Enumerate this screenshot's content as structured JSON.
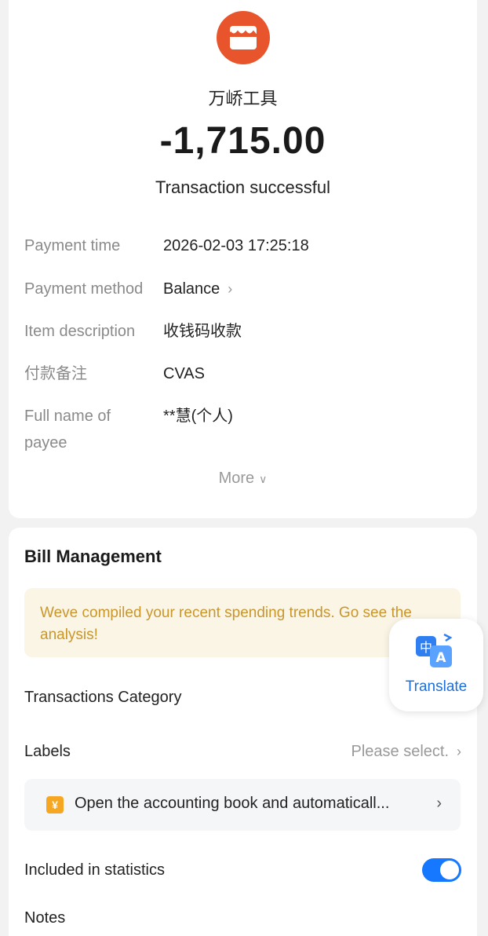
{
  "transaction": {
    "merchant_icon": "store-icon",
    "merchant_name": "万峤工具",
    "amount": "-1,715.00",
    "status": "Transaction successful",
    "details": {
      "payment_time_label": "Payment time",
      "payment_time_value": "2026-02-03 17:25:18",
      "payment_method_label": "Payment method",
      "payment_method_value": "Balance",
      "item_description_label": "Item description",
      "item_description_value": "收钱码收款",
      "remark_label": "付款备注",
      "remark_value": "CVAS",
      "payee_label_line1": "Full name of",
      "payee_label_line2": "payee",
      "payee_value": "**慧(个人)"
    },
    "more_label": "More"
  },
  "bill_management": {
    "title": "Bill Management",
    "banner_text": "Weve compiled your recent spending trends. Go see the analysis!",
    "transactions_category_label": "Transactions Category",
    "labels_label": "Labels",
    "labels_placeholder": "Please select.",
    "accounting_icon_text": "¥",
    "accounting_text": "Open the accounting book and automaticall...",
    "included_in_statistics_label": "Included in statistics",
    "included_in_statistics_on": true,
    "notes_label": "Notes"
  },
  "translate_fab": {
    "icon": "translate-icon",
    "label": "Translate"
  },
  "colors": {
    "merchant_orange": "#e8552c",
    "toggle_blue": "#1677ff",
    "banner_text": "#c9962b",
    "translate_blue": "#1d6fd8"
  }
}
